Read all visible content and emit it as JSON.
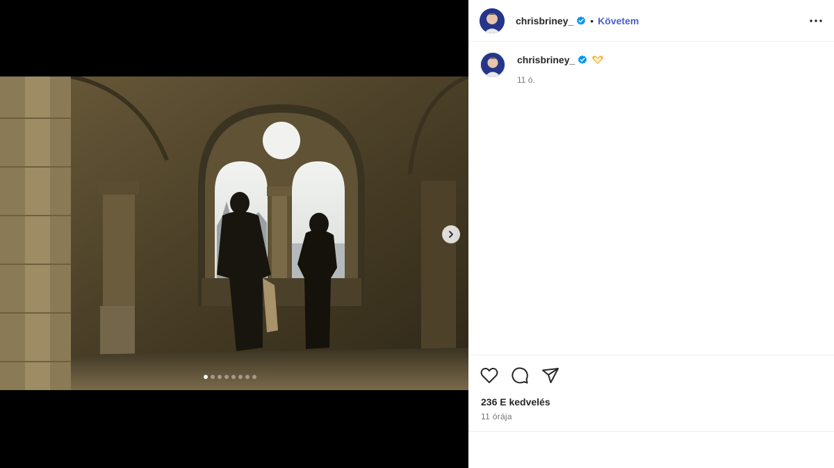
{
  "post": {
    "username": "chrisbriney_",
    "follow_label": "Követem",
    "separator": "•",
    "caption_time": "11 ó.",
    "likes": "236 E kedvelés",
    "posted_ago": "11 órája",
    "carousel": {
      "total_slides": 8,
      "active_slide": 1
    }
  },
  "colors": {
    "verified": "#0095f6",
    "follow": "#4a5dcf",
    "text": "#262626",
    "muted": "#737373"
  },
  "icons": [
    "verified-badge-icon",
    "more-options-icon",
    "heart-icon",
    "comment-icon",
    "share-icon",
    "chevron-right-icon",
    "heart-hands-emoji"
  ]
}
